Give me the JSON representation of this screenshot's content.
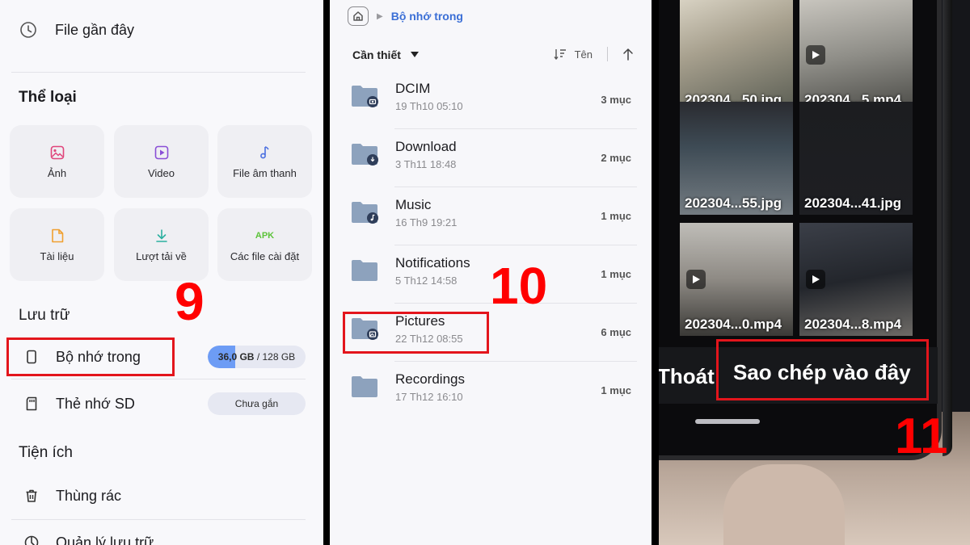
{
  "panel1": {
    "recent_label": "File gần đây",
    "category_heading": "Thể loại",
    "categories": [
      {
        "label": "Ảnh",
        "icon": "image-icon",
        "color": "#e0457b"
      },
      {
        "label": "Video",
        "icon": "video-icon",
        "color": "#8a4fd6"
      },
      {
        "label": "File âm thanh",
        "icon": "music-note-icon",
        "color": "#4a6fe0"
      },
      {
        "label": "Tài liệu",
        "icon": "document-icon",
        "color": "#f0a030"
      },
      {
        "label": "Lượt tải về",
        "icon": "download-icon",
        "color": "#2bb0a0"
      },
      {
        "label": "Các file cài đặt",
        "icon": "apk-icon",
        "icon_text": "APK",
        "color": "#5cc33a"
      }
    ],
    "storage_heading": "Lưu trữ",
    "internal_label": "Bộ nhớ trong",
    "internal_used": "36,0 GB",
    "internal_total": "/ 128 GB",
    "internal_fraction": 0.28,
    "sd_label": "Thẻ nhớ SD",
    "sd_status": "Chưa gắn",
    "utility_heading": "Tiện ích",
    "trash_label": "Thùng rác",
    "manage_label": "Quản lý lưu trữ",
    "step_number": "9"
  },
  "panel2": {
    "breadcrumb_current": "Bộ nhớ trong",
    "sort_filter": "Cần thiết",
    "sort_key": "Tên",
    "folders": [
      {
        "name": "DCIM",
        "date": "19 Th10 05:10",
        "count": "3 mục",
        "badge": "camera"
      },
      {
        "name": "Download",
        "date": "3 Th11 18:48",
        "count": "2 mục",
        "badge": "download"
      },
      {
        "name": "Music",
        "date": "16 Th9 19:21",
        "count": "1 mục",
        "badge": "music"
      },
      {
        "name": "Notifications",
        "date": "5 Th12 14:58",
        "count": "1 mục",
        "badge": ""
      },
      {
        "name": "Pictures",
        "date": "22 Th12 08:55",
        "count": "6 mục",
        "badge": "image"
      },
      {
        "name": "Recordings",
        "date": "17 Th12 16:10",
        "count": "1 mục",
        "badge": ""
      }
    ],
    "step_number": "10"
  },
  "panel3": {
    "thumbnails": [
      {
        "caption": "202304...50.jpg",
        "video": false
      },
      {
        "caption": "202304...5.mp4",
        "video": true
      },
      {
        "caption": "202304...55.jpg",
        "video": false
      },
      {
        "caption": "202304...41.jpg",
        "video": false
      },
      {
        "caption": "202304...0.mp4",
        "video": true
      },
      {
        "caption": "202304...8.mp4",
        "video": true
      }
    ],
    "exit_label": "Thoát",
    "copy_here_label": "Sao chép vào đây",
    "step_number": "11"
  },
  "colors": {
    "highlight": "#e3151c",
    "step_number": "#ff0000",
    "breadcrumb": "#3b6fd6",
    "folder": "#8da2bd",
    "storage_fill": "#6d9cf5"
  }
}
